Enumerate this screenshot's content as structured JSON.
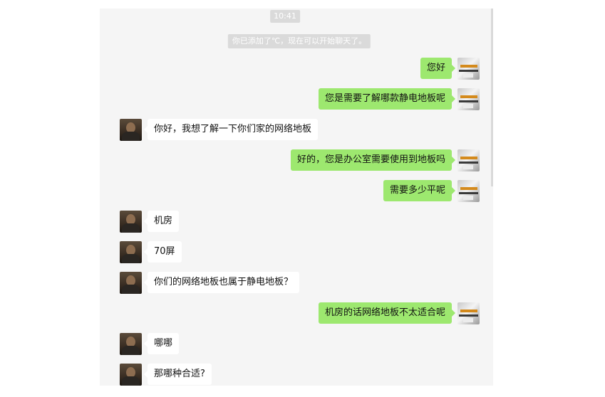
{
  "chat": {
    "time": "10:41",
    "system_notice": "你已添加了℃，现在可以开始聊天了。",
    "messages": [
      {
        "sender": "self",
        "text": "您好"
      },
      {
        "sender": "self",
        "text": "您是需要了解哪款静电地板呢"
      },
      {
        "sender": "other",
        "text": "你好，我想了解一下你们家的网络地板"
      },
      {
        "sender": "self",
        "text": "好的，您是办公室需要使用到地板吗"
      },
      {
        "sender": "self",
        "text": "需要多少平呢"
      },
      {
        "sender": "other",
        "text": "机房"
      },
      {
        "sender": "other",
        "text": "70屏"
      },
      {
        "sender": "other",
        "text": "你们的网络地板也属于静电地板？"
      },
      {
        "sender": "self",
        "text": "机房的话网络地板不太适合呢"
      },
      {
        "sender": "other",
        "text": "哪哪"
      },
      {
        "sender": "other",
        "text": "那哪种合适?"
      }
    ]
  },
  "colors": {
    "window_background": "#f5f5f5",
    "self_bubble": "#9de86f",
    "other_bubble": "#ffffff",
    "pill_background": "#dadada"
  }
}
